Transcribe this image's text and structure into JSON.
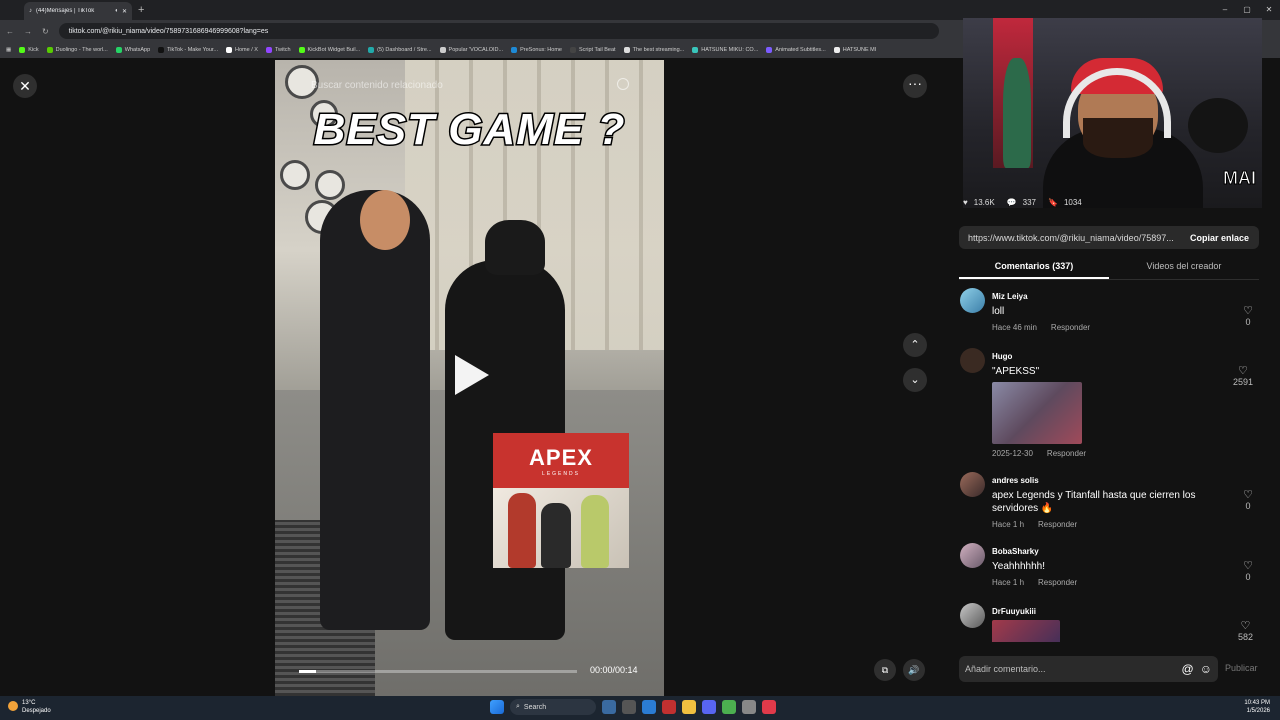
{
  "browser": {
    "tab_title": "(44)Mensajes | TikTok",
    "url": "tiktok.com/@rikiu_niama/video/7589731686946999608?lang=es",
    "bookmarks": [
      "Kick",
      "Duolingo - The worl...",
      "WhatsApp",
      "TikTok - Make Your...",
      "Home / X",
      "Twitch",
      "KickBot Widget Buil...",
      "(5) Dashboard / Stre...",
      "Popular 'VOCALOID...",
      "PreSonus: Home",
      "Script Tail Beat",
      "The best streaming...",
      "HATSUNE MIKU: CO...",
      "Animated Subtitles...",
      "HATSUNE MI"
    ]
  },
  "video": {
    "search_placeholder": "Buscar contenido relacionado",
    "overlay_title": "BEST GAME ?",
    "time": "00:00/00:14",
    "progress": 0.06,
    "sticker_logo": "APEX",
    "sticker_sub": "LEGENDS"
  },
  "stream": {
    "brand": "MAI"
  },
  "stats": {
    "likes": "13.6K",
    "comments": "337",
    "saves": "1034"
  },
  "share": {
    "link": "https://www.tiktok.com/@rikiu_niama/video/75897...",
    "copy_label": "Copiar enlace"
  },
  "tabs": {
    "comments": "Comentarios (337)",
    "creator_videos": "Videos del creador"
  },
  "comments": [
    {
      "user": "Miz Leiya",
      "text": "loll",
      "time": "Hace 46 min",
      "reply": "Responder",
      "likes": "0"
    },
    {
      "user": "Hugo",
      "text": "\"APEKSS\"",
      "time": "2025-12-30",
      "reply": "Responder",
      "likes": "2591"
    },
    {
      "user": "andres solis",
      "text": "apex Legends y Titanfall hasta que cierren los servidores 🔥",
      "time": "Hace 1 h",
      "reply": "Responder",
      "likes": "0"
    },
    {
      "user": "BobaSharky",
      "text": "Yeahhhhhh!",
      "time": "Hace 1 h",
      "reply": "Responder",
      "likes": "0"
    },
    {
      "user": "DrFuuyukiii",
      "text": "",
      "time": "",
      "reply": "",
      "likes": "582"
    }
  ],
  "comment_box": {
    "placeholder": "Añadir comentario...",
    "publish": "Publicar"
  },
  "taskbar": {
    "temp": "13°C",
    "weather": "Despejado",
    "search": "Search",
    "time": "10:43 PM",
    "date": "1/5/2026"
  },
  "colors": {
    "bg": "#121212",
    "panel": "#2a2a2a",
    "accent_red": "#c8332e"
  }
}
